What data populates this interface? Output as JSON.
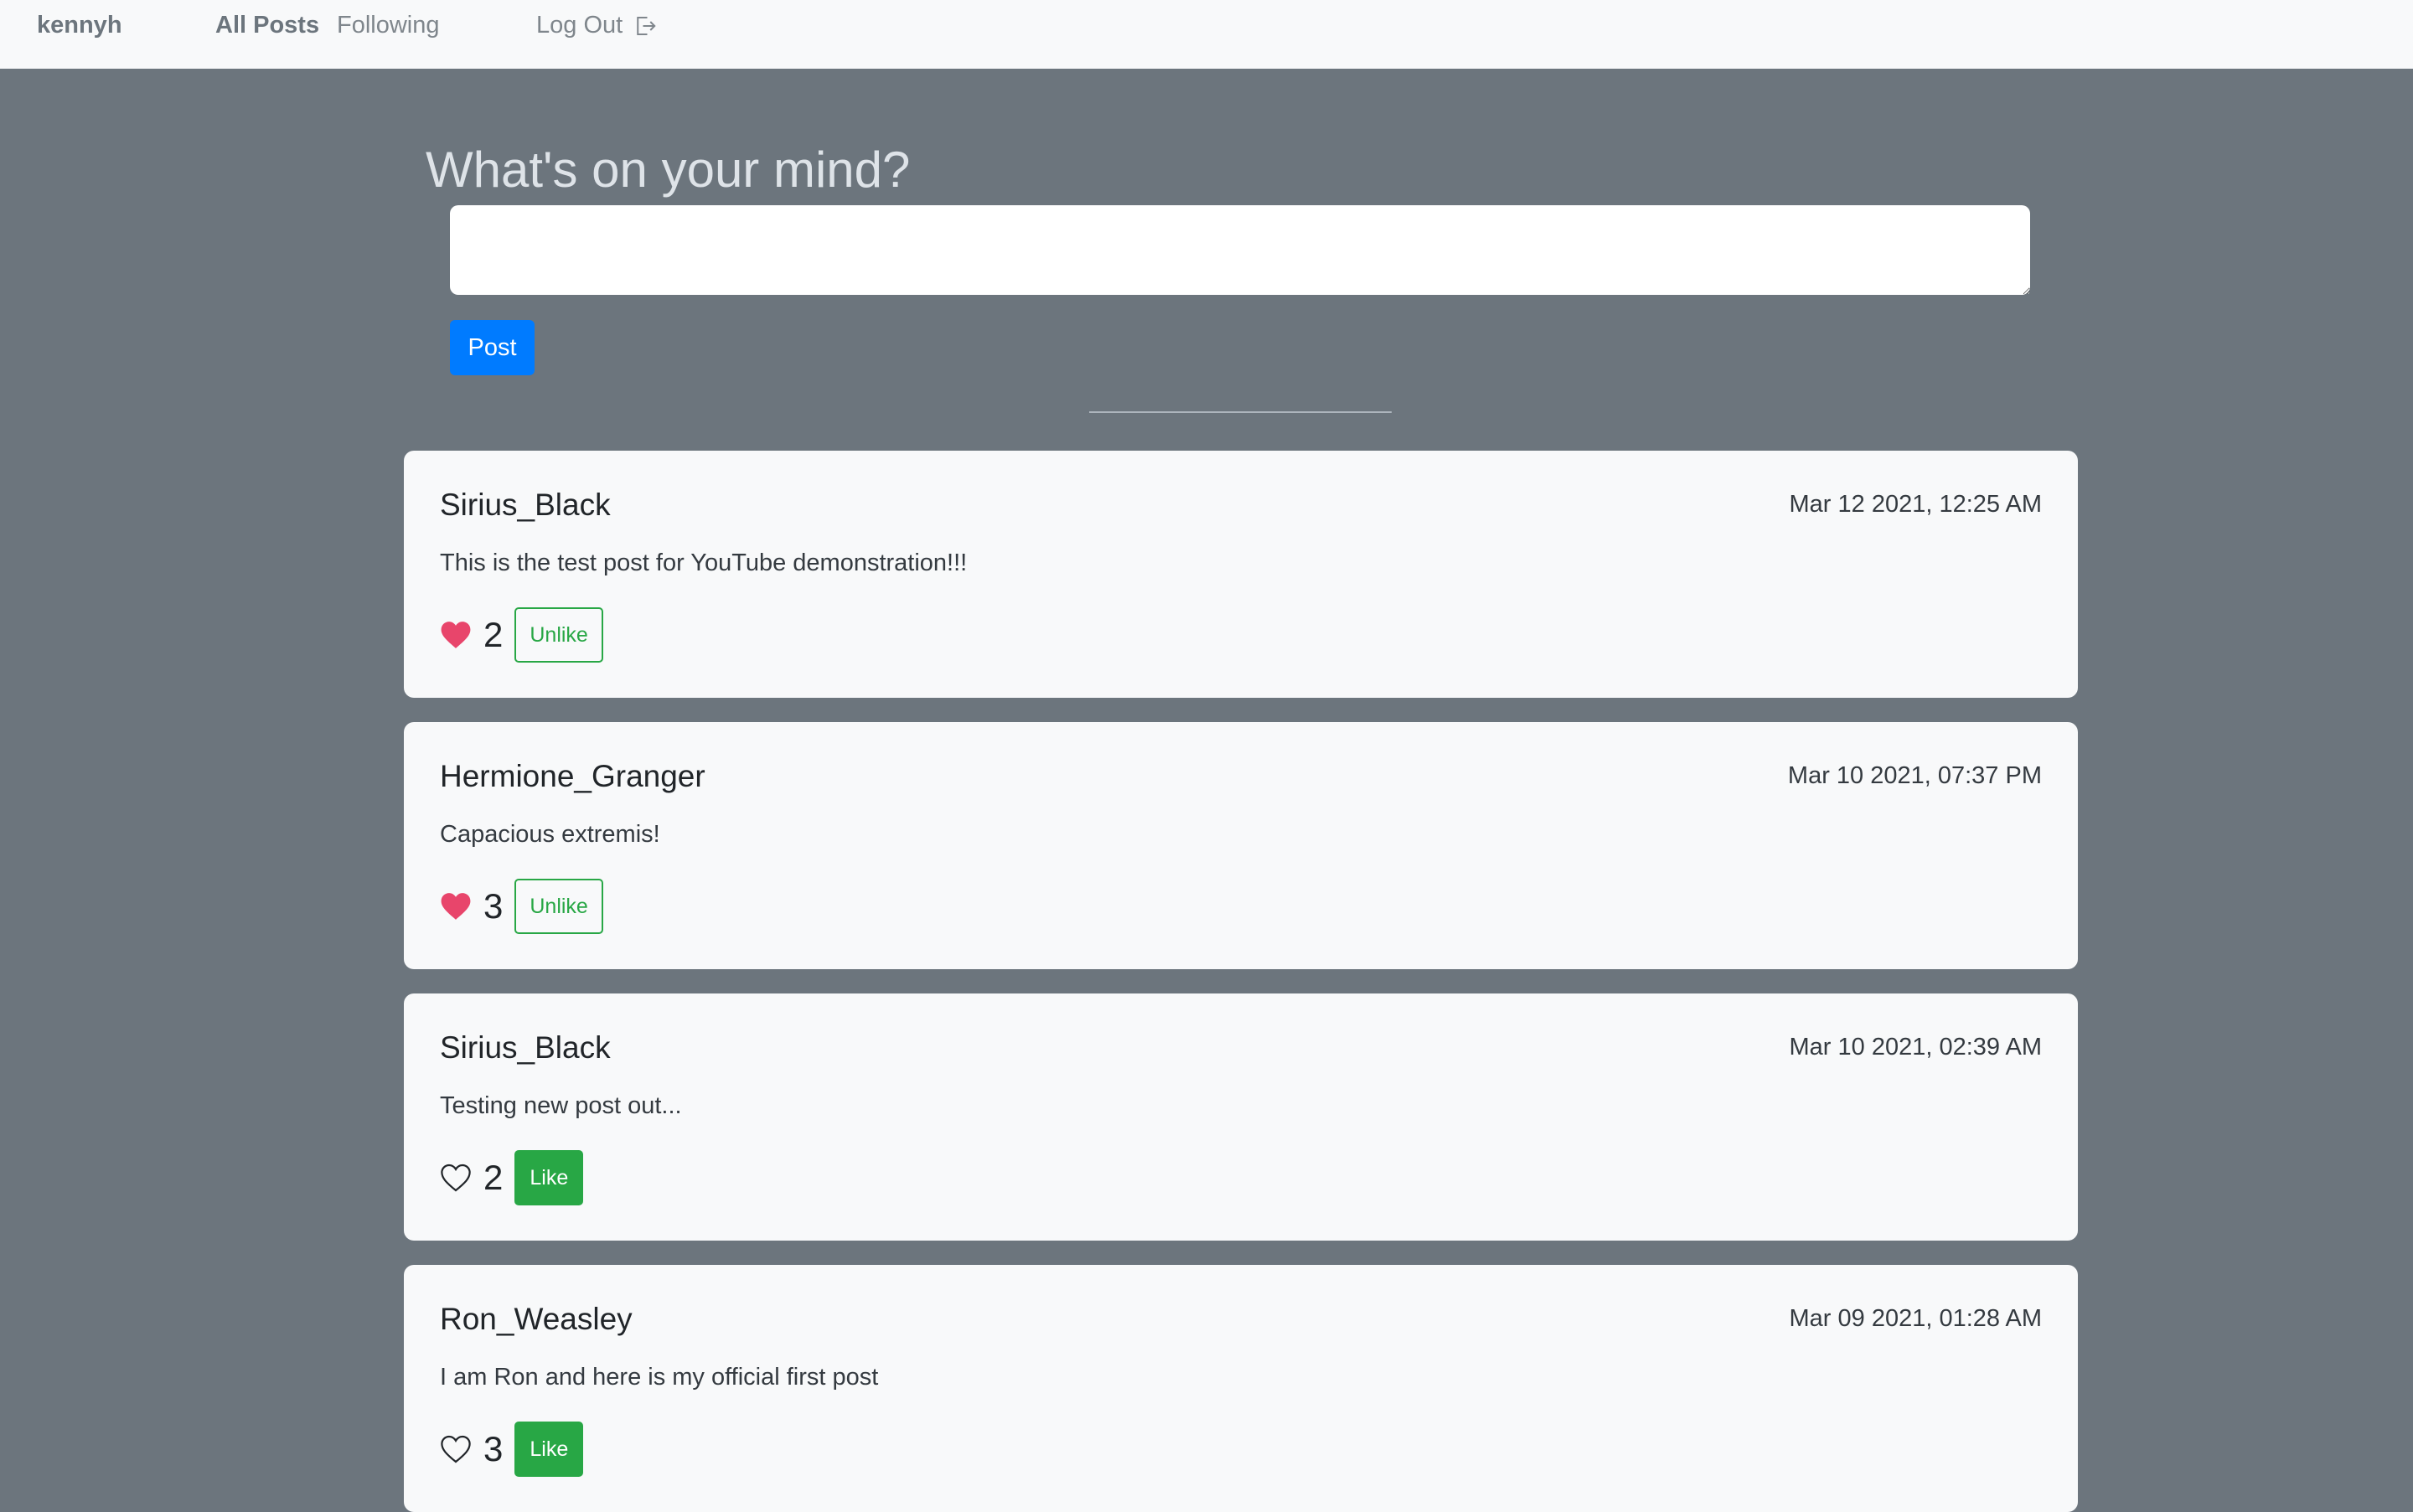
{
  "nav": {
    "brand": "kennyh",
    "all_posts": "All Posts",
    "following": "Following",
    "logout": "Log Out"
  },
  "compose": {
    "title": "What's on your mind?",
    "value": "",
    "post_label": "Post"
  },
  "colors": {
    "accent": "#007bff",
    "like_green": "#28a745",
    "heart_red": "#e8456b",
    "background": "#6c757d"
  },
  "posts": [
    {
      "user": "Sirius_Black",
      "date": "Mar 12 2021, 12:25 AM",
      "body": "This is the test post for YouTube demonstration!!!",
      "likes": "2",
      "liked": true,
      "action": "Unlike"
    },
    {
      "user": "Hermione_Granger",
      "date": "Mar 10 2021, 07:37 PM",
      "body": "Capacious extremis!",
      "likes": "3",
      "liked": true,
      "action": "Unlike"
    },
    {
      "user": "Sirius_Black",
      "date": "Mar 10 2021, 02:39 AM",
      "body": "Testing new post out...",
      "likes": "2",
      "liked": false,
      "action": "Like"
    },
    {
      "user": "Ron_Weasley",
      "date": "Mar 09 2021, 01:28 AM",
      "body": "I am Ron and here is my official first post",
      "likes": "3",
      "liked": false,
      "action": "Like"
    }
  ]
}
